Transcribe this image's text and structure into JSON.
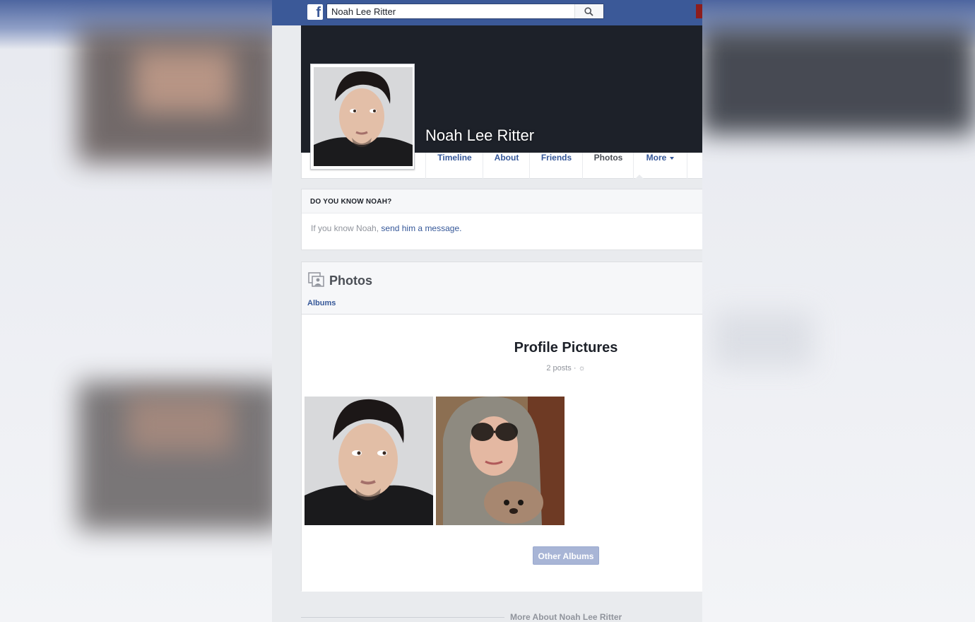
{
  "search": {
    "value": "Noah Lee Ritter"
  },
  "profile": {
    "name": "Noah Lee Ritter"
  },
  "nav": {
    "tabs": [
      {
        "label": "Timeline"
      },
      {
        "label": "About"
      },
      {
        "label": "Friends"
      },
      {
        "label": "Photos",
        "active": true
      },
      {
        "label": "More"
      }
    ]
  },
  "know": {
    "title": "DO YOU KNOW NOAH?",
    "text_prefix": "If you know Noah,",
    "link": "send him a message."
  },
  "photos": {
    "title": "Photos",
    "albums_link": "Albums",
    "album_title": "Profile Pictures",
    "album_meta": "2 posts · ☼",
    "other_albums_button": "Other Albums"
  },
  "footer": {
    "more_about": "More About Noah Lee Ritter"
  },
  "colors": {
    "brand": "#3b5998",
    "link": "#365899",
    "cover": "#1d2129"
  },
  "icons": {
    "logo": "facebook-logo-icon",
    "search": "search-icon",
    "photos": "photos-icon",
    "dropdown": "caret-down-icon"
  }
}
